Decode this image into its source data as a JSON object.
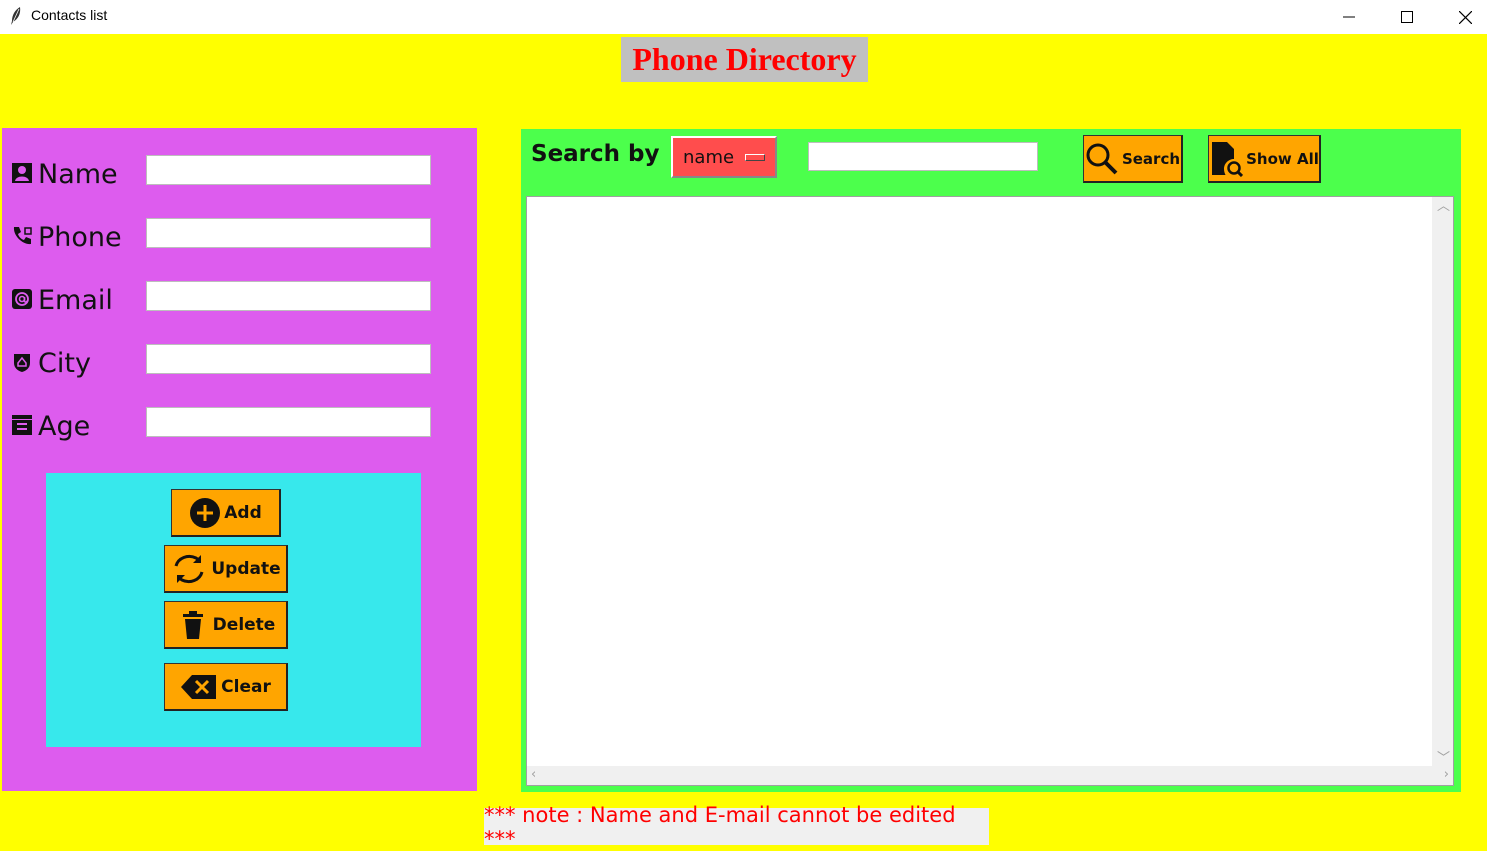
{
  "window": {
    "title": "Contacts list",
    "minimize_glyph": "─",
    "maximize_glyph": "☐",
    "close_glyph": "✕"
  },
  "heading": "Phone Directory",
  "form": {
    "fields": [
      {
        "label": "Name",
        "icon": "contact-card-icon",
        "value": ""
      },
      {
        "label": "Phone",
        "icon": "phone-icon",
        "value": ""
      },
      {
        "label": "Email",
        "icon": "at-sign-icon",
        "value": ""
      },
      {
        "label": "City",
        "icon": "city-badge-icon",
        "value": ""
      },
      {
        "label": "Age",
        "icon": "calendar-icon",
        "value": ""
      }
    ],
    "buttons": {
      "add": "Add",
      "update": "Update",
      "delete": "Delete",
      "clear": "Clear"
    }
  },
  "search": {
    "label": "Search by",
    "selected_option": "name",
    "query": "",
    "search_button": "Search",
    "show_all_button": "Show All"
  },
  "note": "*** note : Name and E-mail cannot be edited ***",
  "colors": {
    "background": "#ffff00",
    "heading_text": "#ff0000",
    "heading_bg": "#c0c0c0",
    "form_panel": "#dd5cee",
    "button_panel": "#37e8ec",
    "results_panel": "#4cff4c",
    "button": "#ffa500",
    "select": "#ff4d4d",
    "note_text": "#ff0000"
  }
}
